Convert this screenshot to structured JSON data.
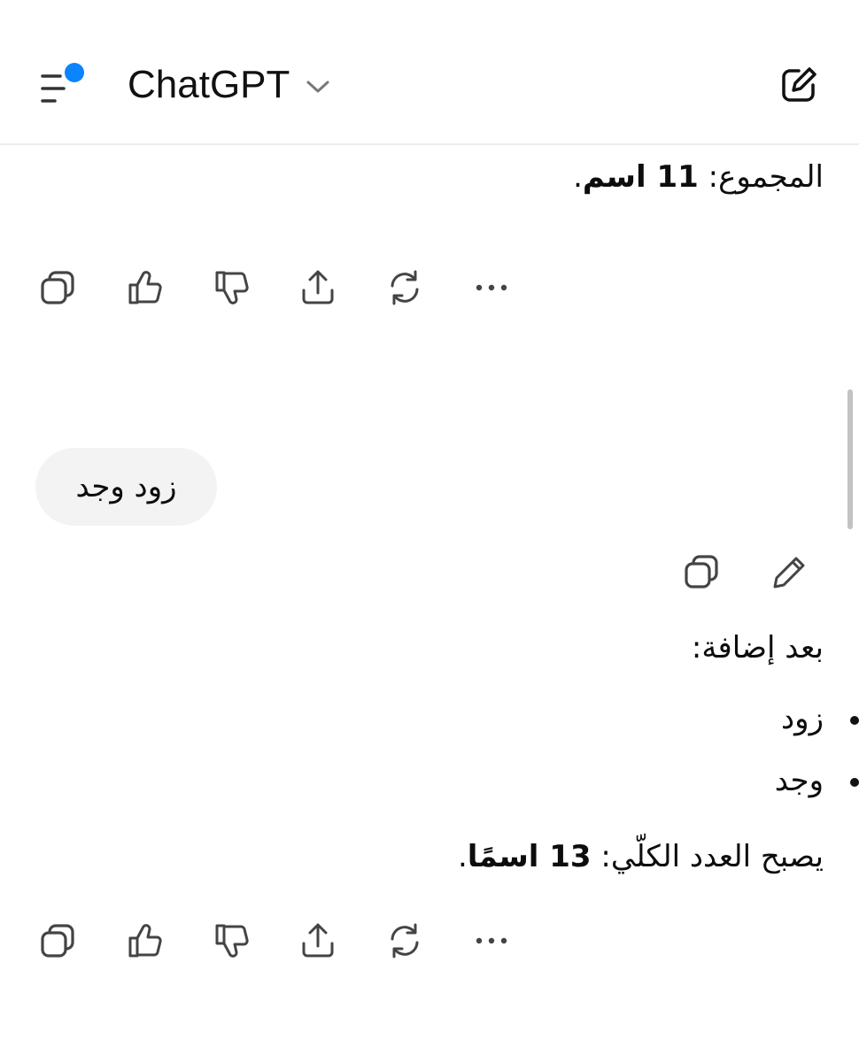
{
  "header": {
    "title": "ChatGPT",
    "menu_icon": "sidebar-menu-icon",
    "notification_color": "#0a84ff",
    "title_dropdown_icon": "chevron-down-icon",
    "new_chat_icon": "compose-icon"
  },
  "conversation": {
    "prev_answer": {
      "total_prefix": "المجموع: ",
      "total_bold": "11 اسم",
      "total_suffix": "."
    },
    "answer_actions_icons": [
      "copy-icon",
      "thumbs-up-icon",
      "thumbs-down-icon",
      "share-icon",
      "regenerate-icon",
      "more-icon"
    ],
    "user_message": {
      "text": "زود وجد",
      "actions_icons": [
        "copy-icon",
        "edit-icon"
      ]
    },
    "answer": {
      "intro": "بعد إضافة:",
      "items": [
        "زود",
        "وجد"
      ],
      "total_prefix": "يصبح العدد الكلّي: ",
      "total_bold": "13 اسمًا",
      "total_suffix": "."
    }
  }
}
